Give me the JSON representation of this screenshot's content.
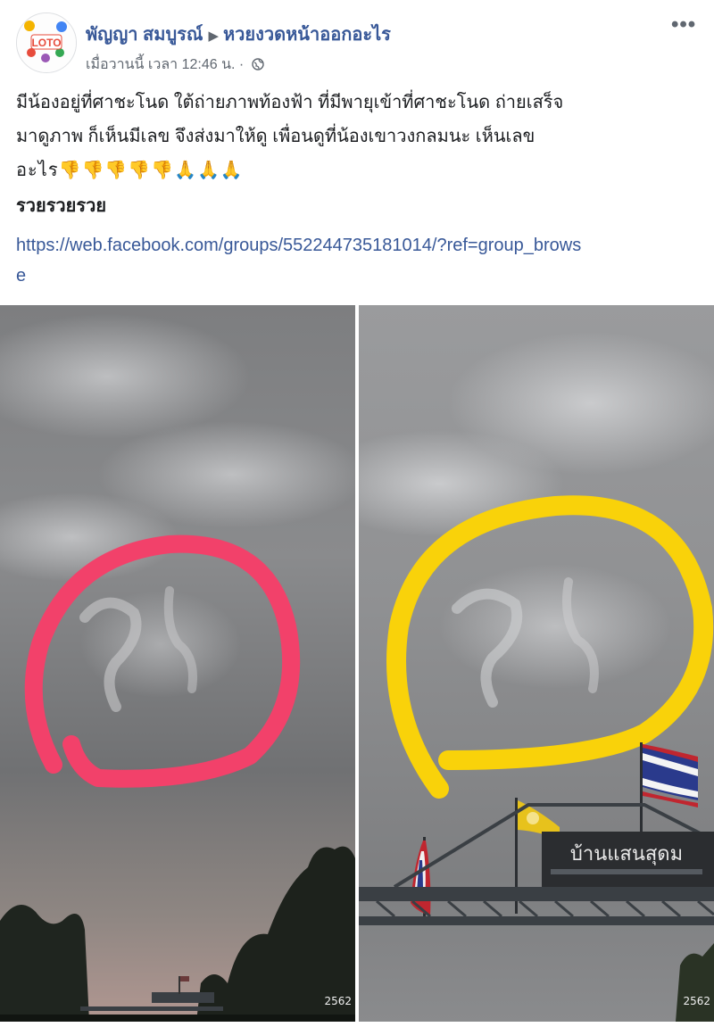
{
  "post": {
    "author": "พัญญา สมบูรณ์",
    "group": "หวยงวดหน้าออกอะไร",
    "timestamp": "เมื่อวานนี้ เวลา 12:46 น.",
    "separator": "·",
    "more_label": "•••",
    "body_lines": [
      "มีน้องอยู่ที่ศาชะโนด ใต้ถ่ายภาพท้องฟ้า ที่มีพายุเข้าที่ศาชะโนด ถ่ายเสร็จ",
      "มาดูภาพ ก็เห็นมีเลข จึงส่งมาให้ดู เพื่อนดูที่น้องเขาวงกลมนะ เห็นเลข",
      "อะไร👎👎👎👎👎🙏🙏🙏"
    ],
    "extra_text": "รวยรวยรวย",
    "link": "https://web.facebook.com/groups/552244735181014/?ref=group_browse"
  },
  "avatar": {
    "logo_text": "LOTO"
  },
  "photos": {
    "left": {
      "watermark": "2562",
      "circle_color": "#f2416a"
    },
    "right": {
      "watermark": "2562",
      "circle_color": "#f9d20a",
      "sign_text": "บ้านแสนสุดม"
    }
  },
  "icons": {
    "privacy": "globe-icon",
    "more": "more-options-icon"
  }
}
